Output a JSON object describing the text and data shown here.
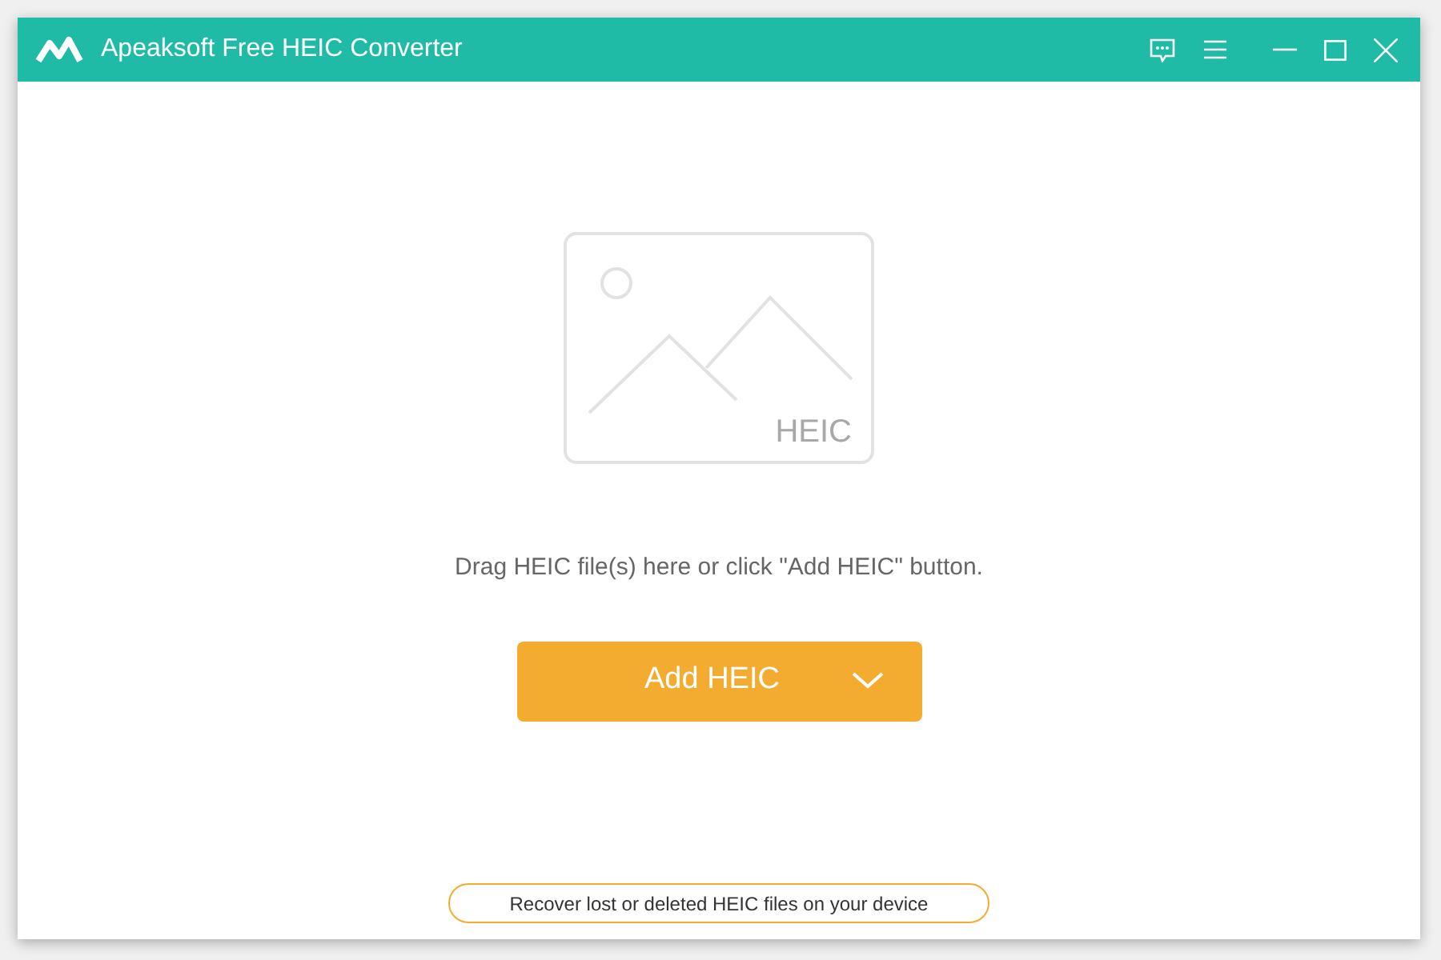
{
  "window": {
    "title": "Apeaksoft Free HEIC Converter"
  },
  "drop_area": {
    "placeholder_label": "HEIC",
    "hint": "Drag HEIC file(s) here or click \"Add HEIC\" button."
  },
  "add_button": {
    "label": "Add HEIC"
  },
  "recover_link": {
    "label": "Recover lost or deleted HEIC files on your device"
  }
}
